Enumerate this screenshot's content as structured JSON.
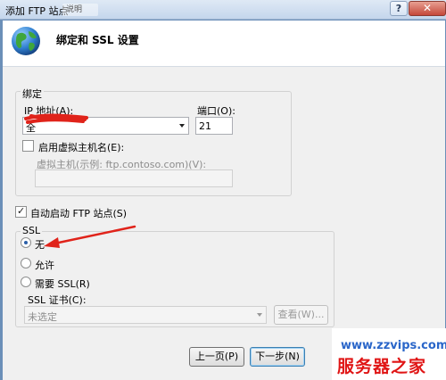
{
  "window": {
    "title": "添加 FTP 站点",
    "background_tab": "说明",
    "help_glyph": "?",
    "close_glyph": "✕"
  },
  "header": {
    "title": "绑定和 SSL 设置",
    "icon": "globe-icon"
  },
  "binding": {
    "group_title": "绑定",
    "ip_label": "IP 地址(A):",
    "ip_value": "全",
    "port_label": "端口(O):",
    "port_value": "21",
    "virtual_host_checkbox_label": "启用虚拟主机名(E):",
    "virtual_host_checked": false,
    "virtual_host_label": "虚拟主机(示例: ftp.contoso.com)(V):",
    "virtual_host_value": ""
  },
  "autostart": {
    "label": "自动启动 FTP 站点(S)",
    "checked": true
  },
  "ssl": {
    "group_title": "SSL",
    "options": [
      {
        "label": "无",
        "selected": true
      },
      {
        "label": "允许",
        "selected": false
      },
      {
        "label": "需要 SSL(R)",
        "selected": false
      }
    ],
    "cert_label": "SSL 证书(C):",
    "cert_value": "未选定",
    "view_button": "查看(W)..."
  },
  "footer": {
    "prev_button": "上一页(P)",
    "next_button": "下一步(N)"
  },
  "watermark": {
    "url": "www.zzvips.com",
    "name": "服务器之家"
  },
  "colors": {
    "annotation_red": "#e0231a",
    "watermark_blue": "#2a66c9",
    "watermark_red": "#e01515"
  }
}
